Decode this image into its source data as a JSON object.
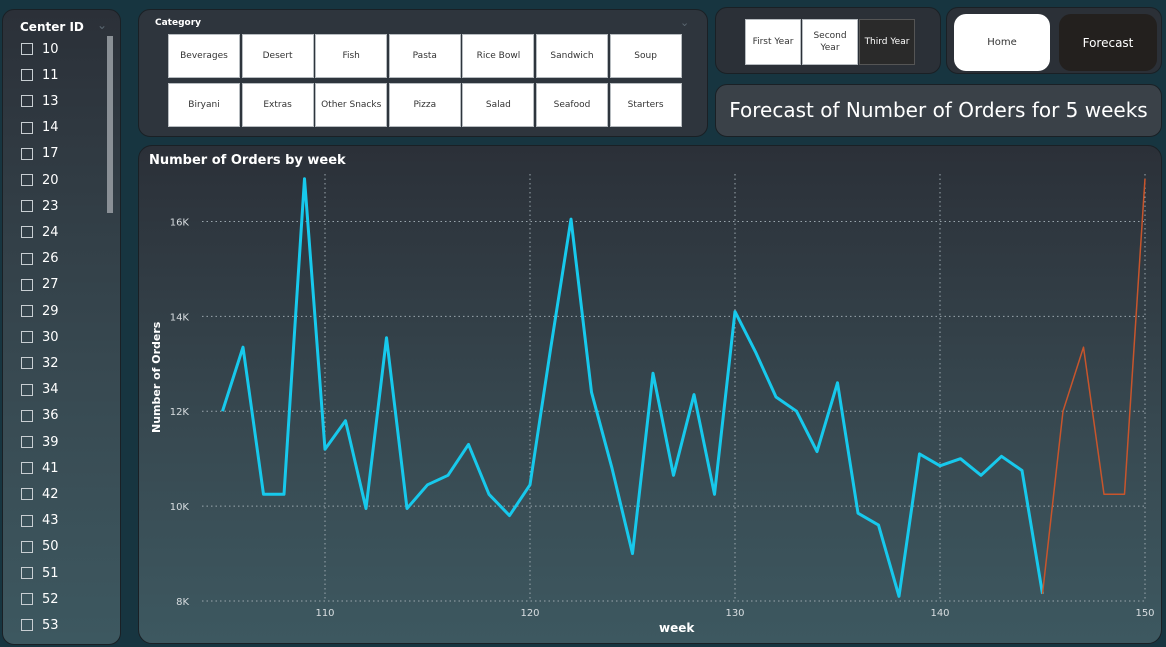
{
  "center_slicer": {
    "title": "Center ID",
    "items": [
      "10",
      "11",
      "13",
      "14",
      "17",
      "20",
      "23",
      "24",
      "26",
      "27",
      "29",
      "30",
      "32",
      "34",
      "36",
      "39",
      "41",
      "42",
      "43",
      "50",
      "51",
      "52",
      "53"
    ]
  },
  "category_slicer": {
    "title": "Category",
    "items": [
      "Beverages",
      "Desert",
      "Fish",
      "Pasta",
      "Rice Bowl",
      "Sandwich",
      "Soup",
      "Biryani",
      "Extras",
      "Other Snacks",
      "Pizza",
      "Salad",
      "Seafood",
      "Starters"
    ]
  },
  "year_buttons": [
    {
      "label": "First Year",
      "selected": false
    },
    {
      "label": "Second Year",
      "selected": false
    },
    {
      "label": "Third Year",
      "selected": true
    }
  ],
  "nav": {
    "home_label": "Home",
    "forecast_label": "Forecast"
  },
  "page_title": "Forecast of Number of Orders for 5 weeks",
  "colors": {
    "actual_line": "#17c9ec",
    "forecast_line": "#c8552c",
    "selected_button": "#2a2a2a"
  },
  "chart_data": {
    "type": "line",
    "title": "Number of Orders by week",
    "xlabel": "week",
    "ylabel": "Number of Orders",
    "xlim": [
      104,
      150
    ],
    "ylim": [
      8000,
      17000
    ],
    "x_ticks": [
      110,
      120,
      130,
      140,
      150
    ],
    "y_ticks": [
      8000,
      10000,
      12000,
      14000,
      16000
    ],
    "y_tick_labels": [
      "8K",
      "10K",
      "12K",
      "14K",
      "16K"
    ],
    "grid": true,
    "series": [
      {
        "name": "actual",
        "x": [
          105,
          106,
          107,
          108,
          109,
          110,
          111,
          112,
          113,
          114,
          115,
          116,
          117,
          118,
          119,
          120,
          121,
          122,
          123,
          124,
          125,
          126,
          127,
          128,
          129,
          130,
          131,
          132,
          133,
          134,
          135,
          136,
          137,
          138,
          139,
          140,
          141,
          142,
          143,
          144,
          145
        ],
        "y": [
          12000,
          13350,
          10250,
          10250,
          16900,
          11200,
          11800,
          9950,
          13550,
          9950,
          10450,
          10650,
          11300,
          10250,
          9800,
          10450,
          13300,
          16050,
          12400,
          10800,
          9000,
          12800,
          10650,
          12350,
          10250,
          14100,
          13250,
          12300,
          12000,
          11150,
          12600,
          9850,
          9600,
          8100,
          11100,
          10850,
          11000,
          10650,
          11050,
          10750,
          8150
        ]
      },
      {
        "name": "forecast",
        "x": [
          145,
          146,
          147,
          148,
          149,
          150
        ],
        "y": [
          8150,
          12000,
          13350,
          10250,
          10250,
          16900
        ]
      }
    ]
  }
}
